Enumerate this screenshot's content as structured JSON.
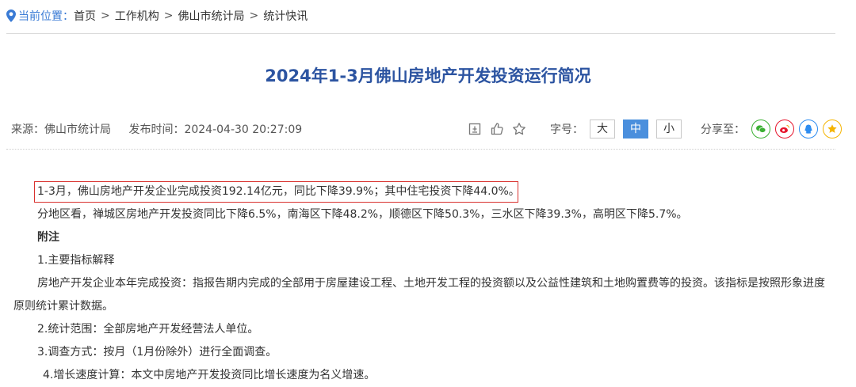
{
  "breadcrumb": {
    "label": "当前位置：",
    "items": [
      "首页",
      "工作机构",
      "佛山市统计局",
      "统计快讯"
    ],
    "separator": ">"
  },
  "article": {
    "title": "2024年1-3月佛山房地产开发投资运行简况",
    "source": "来源：佛山市统计局",
    "publish_time": "发布时间：2024-04-30 20:27:09"
  },
  "toolbar": {
    "icons": [
      "print-icon",
      "like-icon",
      "favorite-icon"
    ],
    "font_size_label": "字号：",
    "font_sizes": [
      "大",
      "中",
      "小"
    ],
    "active_font_size": "中",
    "share_label": "分享至："
  },
  "share": {
    "icons": [
      "wechat-icon",
      "weibo-icon",
      "qq-icon",
      "qzone-icon"
    ]
  },
  "colors": {
    "accent": "#2c54a1",
    "link": "#3a7bd5",
    "active_button": "#4a8fdd",
    "highlight_border": "#d9322f",
    "wechat": "#3cb034",
    "weibo": "#e6162d",
    "qq": "#2d8cf0",
    "qzone": "#f5b400"
  },
  "body": {
    "p1": "1-3月，佛山房地产开发企业完成投资192.14亿元，同比下降39.9%；其中住宅投资下降44.0%。",
    "p2": "分地区看，禅城区房地产开发投资同比下降6.5%，南海区下降48.2%，顺德区下降50.3%，三水区下降39.3%，高明区下降5.7%。",
    "note_title": "附注",
    "n1": "1.主要指标解释",
    "n1_desc_a": "房地产开发企业本年完成投资：指报告期内完成的全部用于房屋建设工程、土地开发工程的投资额以及公益性建筑和土地购置费等的投资。该指标是按照形象进度",
    "n1_desc_b": "原则统计累计数据。",
    "n2": "2.统计范围：全部房地产开发经营法人单位。",
    "n3": "3.调查方式：按月（1月份除外）进行全面调查。",
    "n4": "4.增长速度计算：本文中房地产开发投资同比增长速度为名义增速。"
  }
}
